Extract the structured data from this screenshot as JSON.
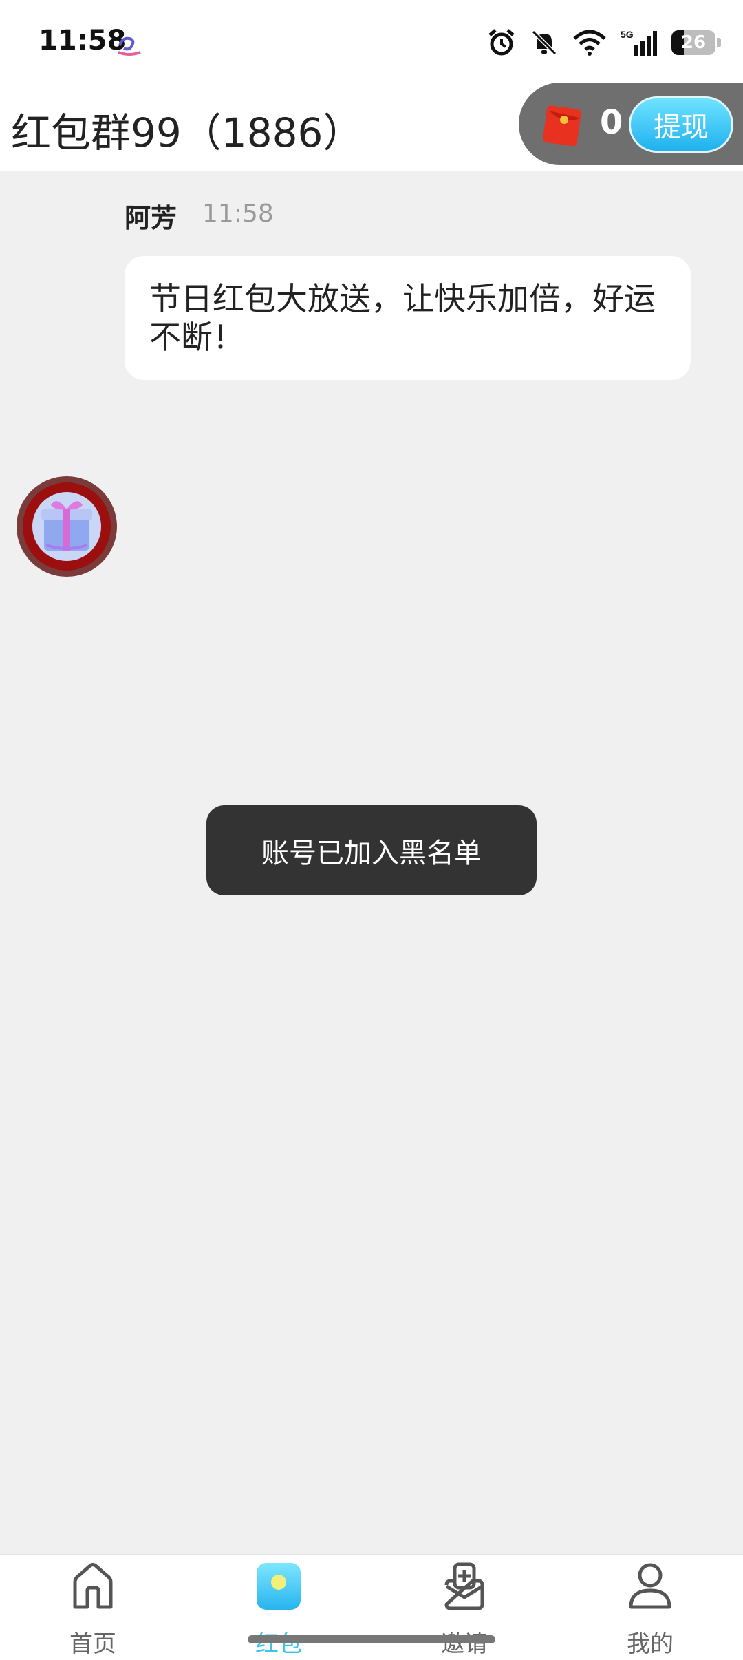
{
  "status_bar": {
    "time": "11:58",
    "battery": "26",
    "network": "5G",
    "icons": [
      "alarm-icon",
      "mute-bell-icon",
      "wifi-icon",
      "signal-icon",
      "battery-icon"
    ]
  },
  "header": {
    "title": "红包群99（1886）",
    "wallet_balance": "0",
    "withdraw_label": "提现"
  },
  "message": {
    "sender": "阿芳",
    "time": "11:58",
    "text": "节日红包大放送，让快乐加倍，好运不断！"
  },
  "toast": {
    "text": "账号已加入黑名单"
  },
  "bottom_nav": {
    "items": [
      {
        "label": "首页",
        "icon": "home-icon"
      },
      {
        "label": "红包",
        "icon": "red-packet-icon",
        "active": true
      },
      {
        "label": "邀请",
        "icon": "invite-icon"
      },
      {
        "label": "我的",
        "icon": "profile-icon"
      }
    ]
  },
  "colors": {
    "accent": "#3cc4ee",
    "background": "#f0f0f0",
    "toast_bg": "#333333",
    "wallet_pill": "#6f6f6f"
  }
}
